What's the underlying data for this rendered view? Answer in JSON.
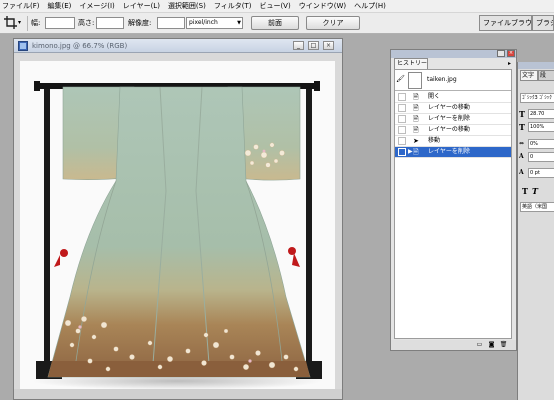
{
  "menu": [
    "ファイル(F)",
    "編集(E)",
    "イメージ(I)",
    "レイヤー(L)",
    "選択範囲(S)",
    "フィルタ(T)",
    "ビュー(V)",
    "ウインドウ(W)",
    "ヘルプ(H)"
  ],
  "options": {
    "width_label": "幅:",
    "height_label": "高さ:",
    "resolution_label": "解像度:",
    "unit_value": "pixel/inch",
    "front_button": "前面",
    "clear_button": "クリア",
    "palette_tab_1": "ファイルブラウザ",
    "palette_tab_2": "ブラシ"
  },
  "document": {
    "title": "kimono.jpg @ 66.7% (RGB)"
  },
  "history": {
    "tab": "ヒストリー",
    "snapshot_label": "taiken.jpg",
    "rows": [
      {
        "label": "開く",
        "selected": false
      },
      {
        "label": "レイヤーの移動",
        "selected": false
      },
      {
        "label": "レイヤーを削除",
        "selected": false
      },
      {
        "label": "レイヤーの移動",
        "selected": false
      },
      {
        "label": "移動",
        "selected": false
      },
      {
        "label": "レイヤーを削除",
        "selected": true
      }
    ]
  },
  "character": {
    "tab_1": "文字",
    "tab_2": "段",
    "font": "ｺﾞｼｯｸ3 ｺﾞｼｯｸ",
    "size": "28.70",
    "leading": "100%",
    "tracking": "0%",
    "kerning": "0",
    "baseline": "0 pt",
    "lang": "英語（米国"
  },
  "colors": {
    "selection": "#2d67c9",
    "kimono_top": "#a9c2b3",
    "kimono_bottom": "#9c6e48"
  }
}
